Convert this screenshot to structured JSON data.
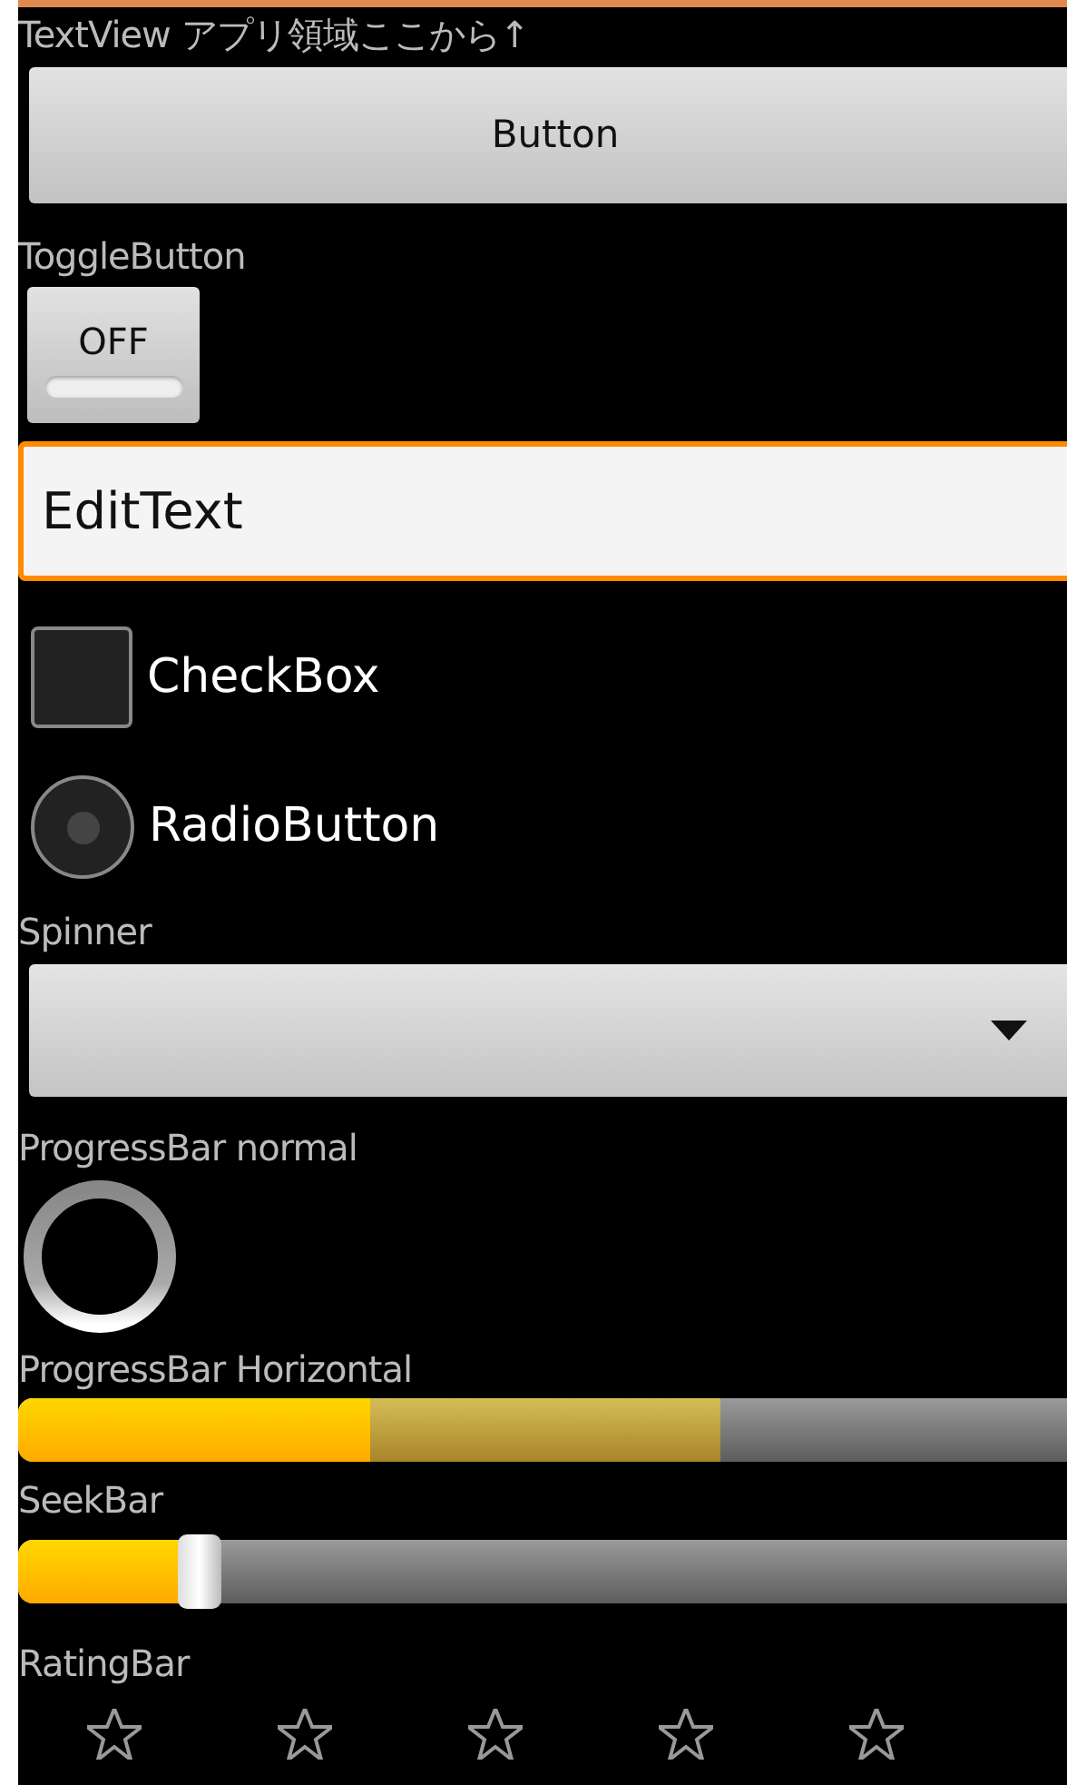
{
  "textview": "TextView アプリ領域ここから↑",
  "button": {
    "label": "Button"
  },
  "toggle": {
    "caption": "ToggleButton",
    "label": "OFF",
    "on": false
  },
  "edit_text": {
    "value": "EditText"
  },
  "checkbox": {
    "label": "CheckBox",
    "checked": false
  },
  "radio": {
    "label": "RadioButton",
    "selected": false
  },
  "spinner": {
    "caption": "Spinner"
  },
  "progress_normal": {
    "caption": "ProgressBar normal"
  },
  "progress_horizontal": {
    "caption": "ProgressBar Horizontal",
    "level": 0.335,
    "secondary": {
      "level": 0.67
    }
  },
  "seekbar": {
    "caption": "SeekBar",
    "level": 0.16
  },
  "ratingbar": {
    "caption": "RatingBar",
    "stars": 0
  }
}
